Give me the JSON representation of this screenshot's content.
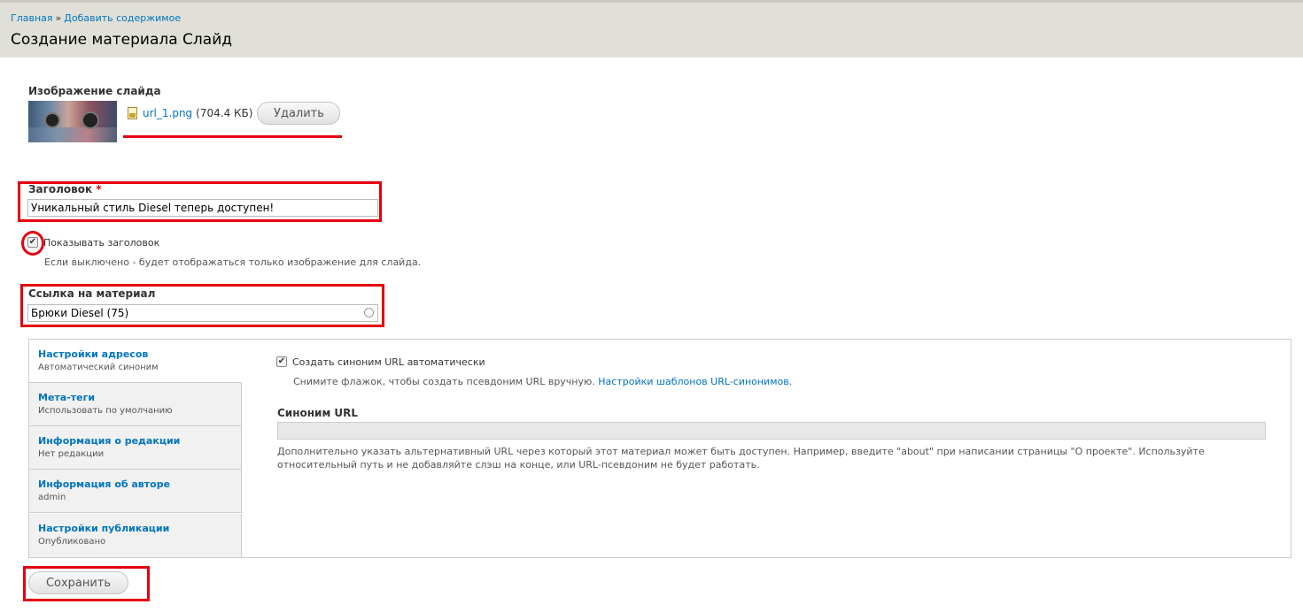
{
  "breadcrumb": {
    "home": "Главная",
    "sep": "»",
    "current": "Добавить содержимое"
  },
  "page_title": "Создание материала Слайд",
  "image_field": {
    "label": "Изображение слайда",
    "file_name": "url_1.png",
    "file_size": "(704.4 КБ)",
    "remove_label": "Удалить"
  },
  "title_field": {
    "label": "Заголовок",
    "required_mark": "*",
    "value": "Уникальный стиль Diesel теперь доступен!"
  },
  "show_title": {
    "label": "Показывать заголовок",
    "checked": true,
    "description": "Если выключено - будет отображаться только изображение для слайда."
  },
  "link_field": {
    "label": "Ссылка на материал",
    "value": "Брюки Diesel (75)"
  },
  "vertical_tabs": [
    {
      "title": "Настройки адресов",
      "summary": "Автоматический синоним"
    },
    {
      "title": "Мета-теги",
      "summary": "Использовать по умолчанию"
    },
    {
      "title": "Информация о редакции",
      "summary": "Нет редакции"
    },
    {
      "title": "Информация об авторе",
      "summary": "admin"
    },
    {
      "title": "Настройки публикации",
      "summary": "Опубликовано"
    }
  ],
  "url_settings": {
    "auto_label": "Создать синоним URL автоматически",
    "auto_checked": true,
    "auto_description": "Снимите флажок, чтобы создать псевдоним URL вручную.",
    "patterns_link": "Настройки шаблонов URL-синонимов",
    "patterns_link_suffix": ".",
    "alias_label": "Синоним URL",
    "alias_value": "",
    "alias_description": "Дополнительно указать альтернативный URL через который этот материал может быть доступен. Например, введите \"about\" при написании страницы \"О проекте\". Используйте относительный путь и не добавляйте слэш на конце, или URL-псевдоним не будет работать."
  },
  "save_label": "Сохранить",
  "annotation_color": "#e4000f",
  "link_color": "#0074bd"
}
